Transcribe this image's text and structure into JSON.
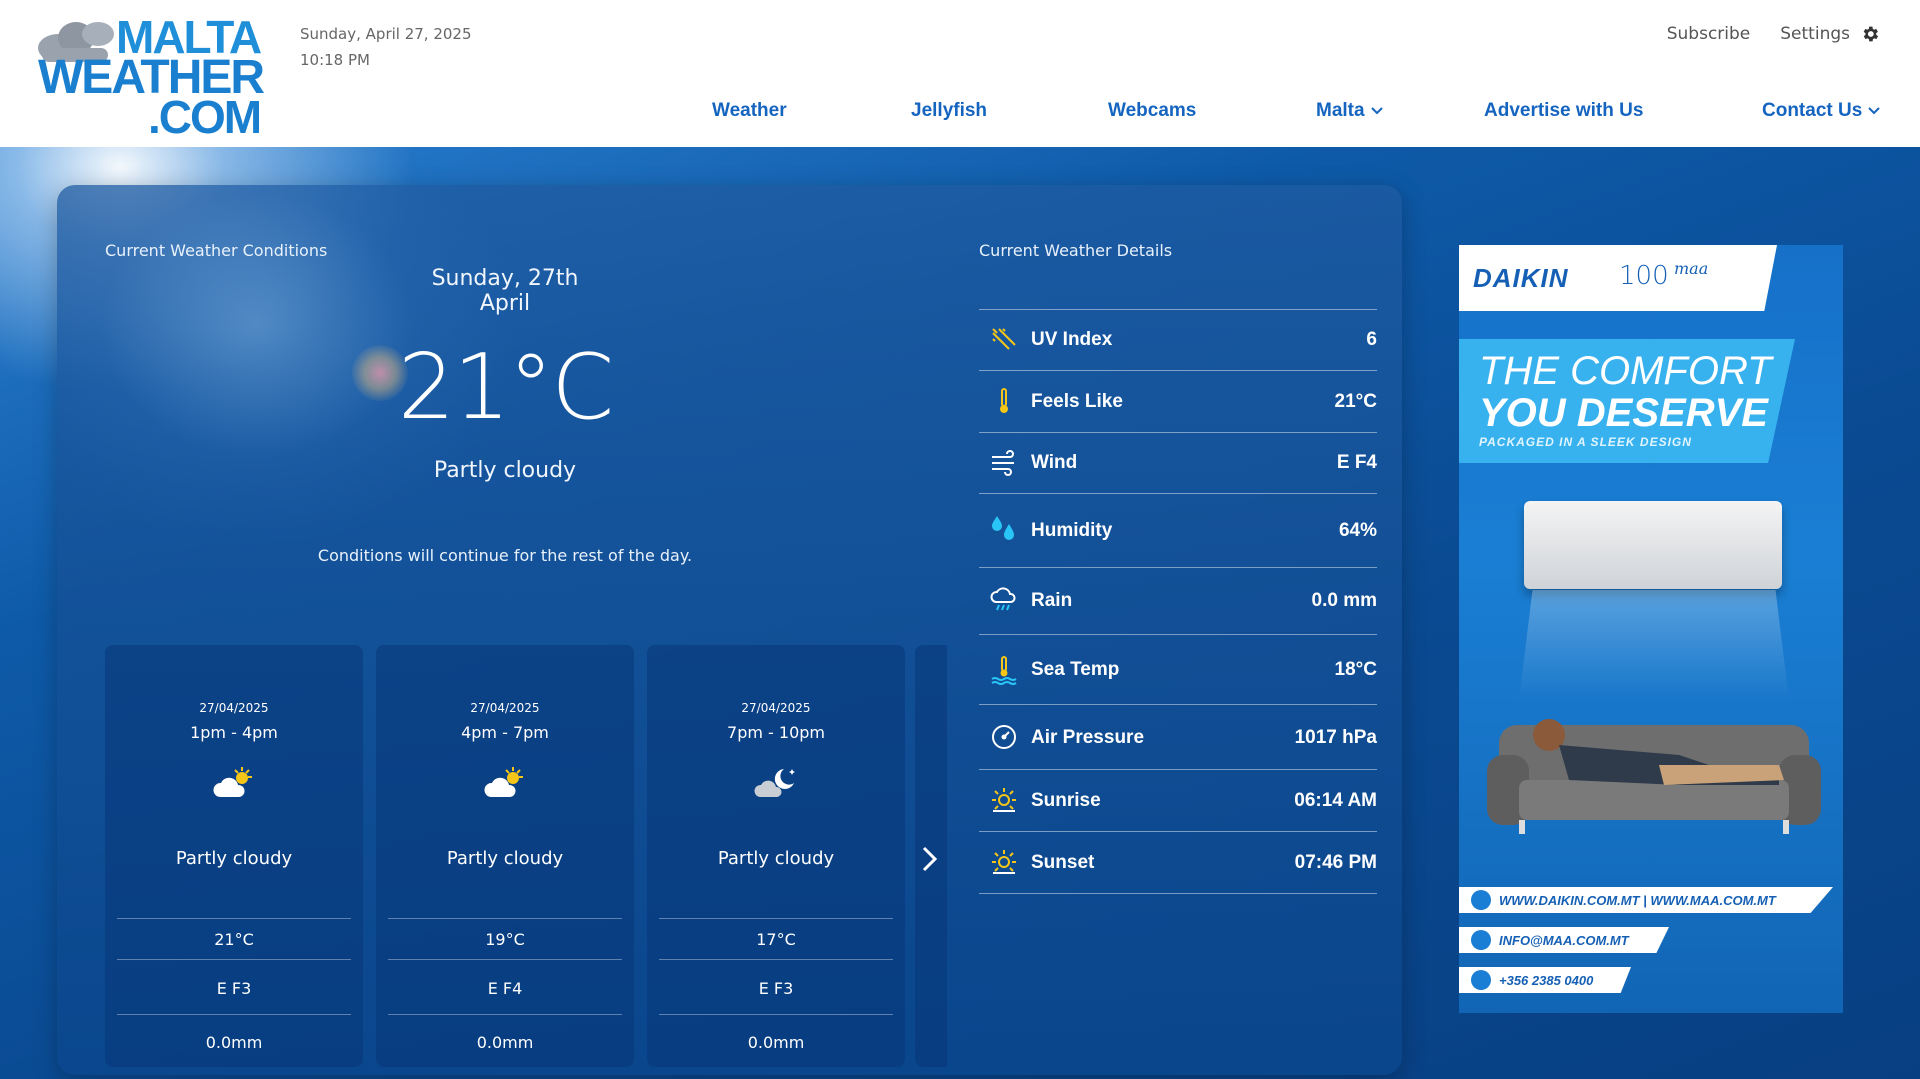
{
  "header": {
    "logo": {
      "line1": "MALTA",
      "line2": "WEATHER",
      "line3": ".COM"
    },
    "date": "Sunday, April 27, 2025",
    "time": "10:18 PM",
    "subscribe_label": "Subscribe",
    "settings_label": "Settings",
    "nav": [
      {
        "label": "Weather",
        "dropdown": false
      },
      {
        "label": "Jellyfish",
        "dropdown": false
      },
      {
        "label": "Webcams",
        "dropdown": false
      },
      {
        "label": "Malta",
        "dropdown": true
      },
      {
        "label": "Advertise with Us",
        "dropdown": false
      },
      {
        "label": "Contact Us",
        "dropdown": true
      }
    ]
  },
  "conditions": {
    "title": "Current Weather Conditions",
    "date": "Sunday, 27th April",
    "temperature": "21°C",
    "description": "Partly cloudy",
    "note": "Conditions will continue for the rest of the day."
  },
  "forecast": [
    {
      "date": "27/04/2025",
      "time": "1pm - 4pm",
      "icon": "partly-cloudy-day-icon",
      "description": "Partly cloudy",
      "temp": "21°C",
      "wind": "E F3",
      "rain": "0.0mm"
    },
    {
      "date": "27/04/2025",
      "time": "4pm - 7pm",
      "icon": "partly-cloudy-day-icon",
      "description": "Partly cloudy",
      "temp": "19°C",
      "wind": "E F4",
      "rain": "0.0mm"
    },
    {
      "date": "27/04/2025",
      "time": "7pm - 10pm",
      "icon": "partly-cloudy-night-icon",
      "description": "Partly cloudy",
      "temp": "17°C",
      "wind": "E F3",
      "rain": "0.0mm"
    }
  ],
  "details": {
    "title": "Current Weather Details",
    "rows": [
      {
        "label": "UV Index",
        "value": "6",
        "icon": "uv-icon"
      },
      {
        "label": "Feels Like",
        "value": "21°C",
        "icon": "thermometer-icon"
      },
      {
        "label": "Wind",
        "value": "E F4",
        "icon": "wind-icon"
      },
      {
        "label": "Humidity",
        "value": "64%",
        "icon": "droplets-icon"
      },
      {
        "label": "Rain",
        "value": "0.0 mm",
        "icon": "rain-cloud-icon"
      },
      {
        "label": "Sea Temp",
        "value": "18°C",
        "icon": "sea-temp-icon"
      },
      {
        "label": "Air Pressure",
        "value": "1017 hPa",
        "icon": "pressure-gauge-icon"
      },
      {
        "label": "Sunrise",
        "value": "06:14 AM",
        "icon": "sunrise-icon"
      },
      {
        "label": "Sunset",
        "value": "07:46 PM",
        "icon": "sunset-icon"
      }
    ]
  },
  "ad": {
    "brand": "DAIKIN",
    "anniversary": "100",
    "partner": "maa",
    "headline1": "THE COMFORT",
    "headline2": "YOU DESERVE",
    "tagline": "PACKAGED IN A SLEEK DESIGN",
    "website": "WWW.DAIKIN.COM.MT | WWW.MAA.COM.MT",
    "email": "INFO@MAA.COM.MT",
    "phone": "+356 2385 0400"
  },
  "colors": {
    "brand_blue": "#1565c0",
    "logo_blue": "#1e8fd8",
    "hero_blue": "#0b4a93",
    "icon_yellow": "#f5c518",
    "icon_cyan": "#29c5f6"
  }
}
